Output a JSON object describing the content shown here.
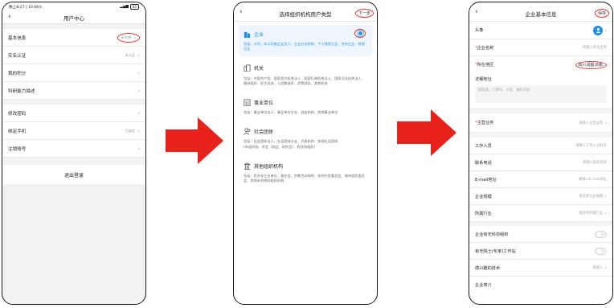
{
  "phone1": {
    "status": {
      "time": "晚上8:27 | 10.6K/s",
      "battery": "85"
    },
    "title": "用户中心",
    "rows": [
      {
        "label": "基本信息",
        "value": "未完善"
      },
      {
        "label": "实名认证",
        "value": "未认证"
      },
      {
        "label": "我的积分",
        "value": ""
      },
      {
        "label": "科研能力描述",
        "value": ""
      },
      {
        "label": "修改密码",
        "value": ""
      },
      {
        "label": "绑定手机",
        "value": "已绑定"
      },
      {
        "label": "注销账号",
        "value": ""
      }
    ],
    "logout": "退出登录"
  },
  "phone2": {
    "title": "选择组织机构用户类型",
    "next": "下一步",
    "types": [
      {
        "name": "企业",
        "desc": "包括：公司、非公司制企业法人、企业分支机构、个人独资企业、合伙企业、其他企业",
        "icon": "building-icon"
      },
      {
        "name": "机关",
        "desc": "包括：中国共产党、国家权力机关法人、国家行政机关法人、国家司法机关法人、政协组织、民主党派、人民解放军、武警部队、其他机关",
        "icon": "government-icon"
      },
      {
        "name": "事业单位",
        "desc": "包括：事业单位法人、事业单位分支、派出机构、其他事业单位",
        "icon": "institution-icon"
      },
      {
        "name": "社会团体",
        "desc_lines": [
          "包括：社会团体法人、社会团体分支、代表机构、其他社会团体",
          "(市县科协、学会（协会、研究会）、农技协组织)"
        ],
        "icon": "group-icon"
      },
      {
        "name": "其他组织机构",
        "desc": "包括：民办非企业单位、基金会、宗教活动场所、农村村民委员会、城市居民委员会、其他未列明的组织机构",
        "icon": "other-org-icon"
      }
    ],
    "accent": "#1f8fe6"
  },
  "phone3": {
    "title": "企业基本信息",
    "save": "保存",
    "avatar_label": "头像",
    "fields_top": [
      {
        "label": "企业名称",
        "placeholder": "请输入单位名称",
        "required": true
      },
      {
        "label": "所在地区",
        "value": "四川,成都,新都,",
        "required": true
      }
    ],
    "address_label": "详细地址",
    "address_placeholder": "如街道、门牌号、小区、楼栋号等",
    "main_business": {
      "label": "主营业务",
      "placeholder": "请输入主营业务"
    },
    "fields": [
      {
        "label": "工作人员",
        "placeholder": "请输入工作人员姓名"
      },
      {
        "label": "联系电话",
        "placeholder": "请输入联系电话"
      },
      {
        "label": "E-mail地址",
        "placeholder": "请输入E-mail地址"
      },
      {
        "label": "企业规模",
        "placeholder": "请选择企业规模"
      },
      {
        "label": "所属行业",
        "placeholder": "请选择所属行业"
      }
    ],
    "toggles": [
      {
        "label": "企业有无科协组织"
      },
      {
        "label": "有无院士(专家)工作站"
      }
    ],
    "interest": {
      "label": "感兴趣的技术",
      "placeholder": "请输入"
    },
    "last_label": "企业简介"
  },
  "arrow_color": "#e8221b"
}
